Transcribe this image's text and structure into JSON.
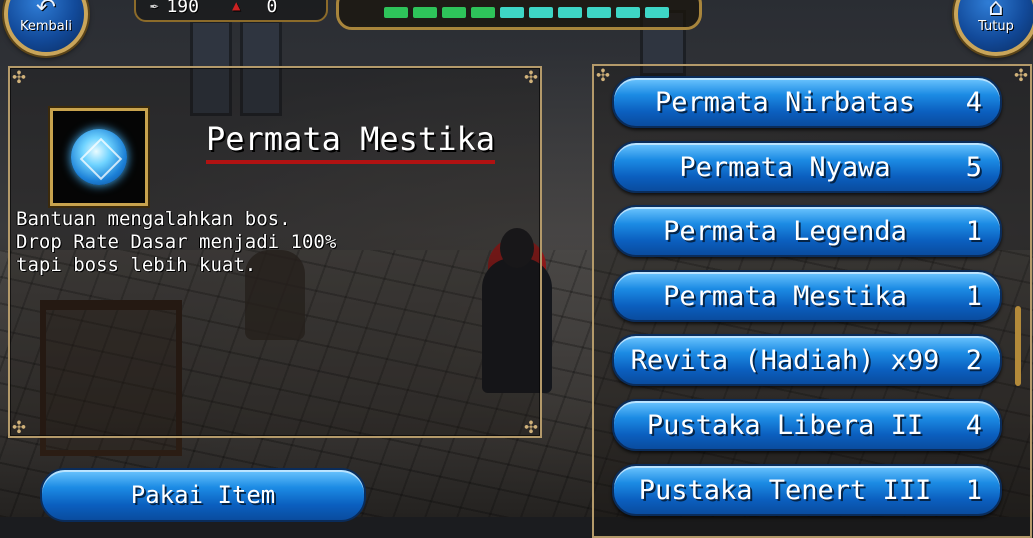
{
  "hud": {
    "back_label": "Kembali",
    "close_label": "Tutup",
    "stat_a_value": "190",
    "stat_b_value": "0",
    "segments": [
      "#2ec35a",
      "#2ec35a",
      "#2ec35a",
      "#2ec35a",
      "#3ed6c6",
      "#3ed6c6",
      "#3ed6c6",
      "#3ed6c6",
      "#3ed6c6",
      "#3ed6c6"
    ]
  },
  "detail": {
    "title": "Permata Mestika",
    "description_lines": [
      "Bantuan mengalahkan bos.",
      "Drop Rate Dasar menjadi 100%",
      "tapi boss lebih kuat."
    ],
    "use_label": "Pakai Item"
  },
  "items": [
    {
      "name": "Permata Nirbatas",
      "count": "4"
    },
    {
      "name": "Permata Nyawa",
      "count": "5"
    },
    {
      "name": "Permata Legenda",
      "count": "1"
    },
    {
      "name": "Permata Mestika",
      "count": "1"
    },
    {
      "name": "Revita (Hadiah) x99",
      "count": "2"
    },
    {
      "name": "Pustaka Libera II",
      "count": "4"
    },
    {
      "name": "Pustaka Tenert III",
      "count": "1"
    }
  ],
  "colors": {
    "accent_gold": "#c9a55a",
    "button_blue": "#1c8be4",
    "title_underline": "#b11212"
  }
}
